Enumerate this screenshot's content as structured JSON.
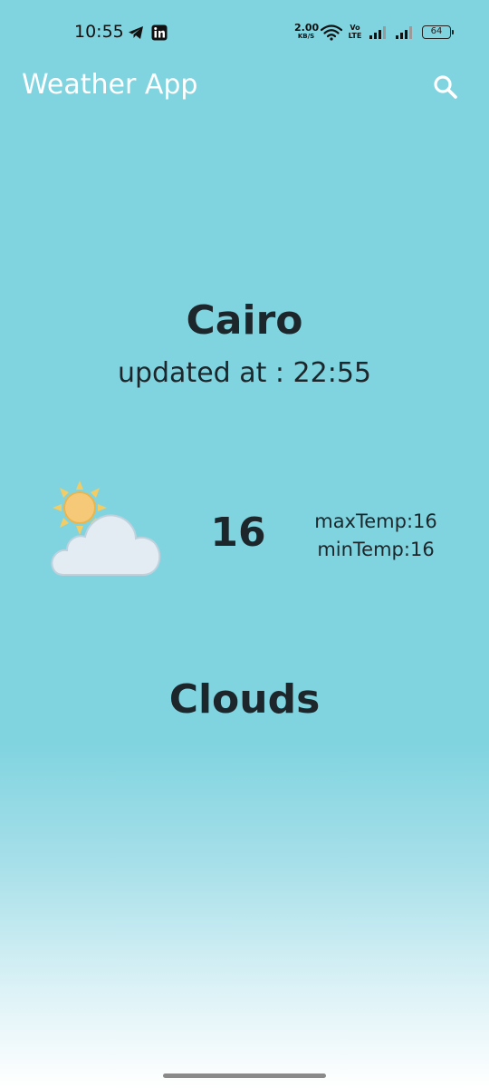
{
  "status_bar": {
    "time": "10:55",
    "net_speed_value": "2.00",
    "net_speed_unit": "KB/S",
    "volte_top": "Vo",
    "volte_bottom": "LTE",
    "battery": "64"
  },
  "app_bar": {
    "title": "Weather App",
    "search_icon": "search-icon"
  },
  "weather": {
    "city": "Cairo",
    "updated": "updated at : 22:55",
    "icon": "partly-cloudy-icon",
    "temp": "16",
    "max_temp": "maxTemp:16",
    "min_temp": "minTemp:16",
    "condition": "Clouds"
  },
  "colors": {
    "background": "#80d4e0",
    "text": "#1c262b",
    "title": "#ffffff"
  }
}
